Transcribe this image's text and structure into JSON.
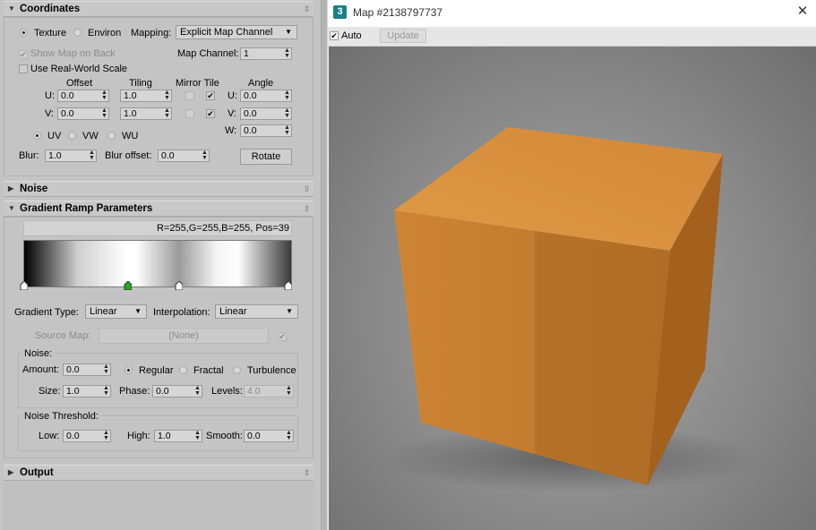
{
  "sections": {
    "coordinates": "Coordinates",
    "noise": "Noise",
    "gradient_ramp": "Gradient Ramp Parameters",
    "output": "Output"
  },
  "coordinates": {
    "texture_label": "Texture",
    "environ_label": "Environ",
    "mapping_label": "Mapping:",
    "mapping_value": "Explicit Map Channel",
    "show_map_label": "Show Map on Back",
    "map_channel_label": "Map Channel:",
    "map_channel_value": "1",
    "real_world_label": "Use Real-World Scale",
    "offset_header": "Offset",
    "tiling_header": "Tiling",
    "mirror_tile_header": "Mirror Tile",
    "angle_header": "Angle",
    "u_label": "U:",
    "v_label": "V:",
    "w_label": "W:",
    "offset_u": "0.0",
    "offset_v": "0.0",
    "tiling_u": "1.0",
    "tiling_v": "1.0",
    "angle_u": "0.0",
    "angle_v": "0.0",
    "angle_w": "0.0",
    "uv_label": "UV",
    "vw_label": "VW",
    "wu_label": "WU",
    "blur_label": "Blur:",
    "blur_value": "1.0",
    "blur_offset_label": "Blur offset:",
    "blur_offset_value": "0.0",
    "rotate_label": "Rotate"
  },
  "gradient": {
    "info": "R=255,G=255,B=255, Pos=39",
    "flag_positions": [
      0,
      39,
      58,
      100
    ],
    "selected_flag": 39,
    "gradient_type_label": "Gradient Type:",
    "gradient_type_value": "Linear",
    "interpolation_label": "Interpolation:",
    "interpolation_value": "Linear",
    "source_map_label": "Source Map:",
    "source_map_value": "(None)",
    "noise_group_label": "Noise:",
    "amount_label": "Amount:",
    "amount_value": "0.0",
    "regular_label": "Regular",
    "fractal_label": "Fractal",
    "turbulence_label": "Turbulence",
    "size_label": "Size:",
    "size_value": "1.0",
    "phase_label": "Phase:",
    "phase_value": "0.0",
    "levels_label": "Levels:",
    "levels_value": "4.0",
    "threshold_group_label": "Noise Threshold:",
    "low_label": "Low:",
    "low_value": "0.0",
    "high_label": "High:",
    "high_value": "1.0",
    "smooth_label": "Smooth:",
    "smooth_value": "0.0"
  },
  "viewer": {
    "app_badge": "3",
    "title": "Map #2138797737",
    "close_glyph": "✕",
    "auto_label": "Auto",
    "update_label": "Update"
  },
  "colors": {
    "selected_flag": "#22aa22",
    "cube_top": "#d9913a",
    "cube_front": "#c27a2c",
    "cube_right": "#a8641f"
  }
}
